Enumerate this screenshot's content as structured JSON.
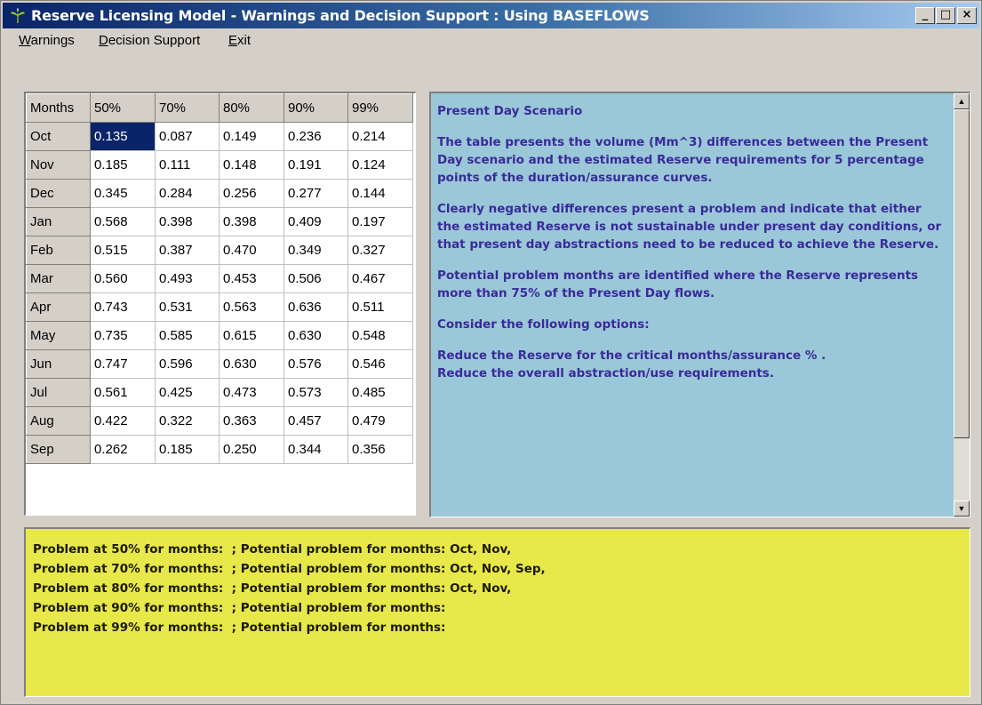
{
  "window": {
    "title": "Reserve Licensing Model - Warnings and Decision Support : Using BASEFLOWS",
    "controls": {
      "minimize": "_",
      "maximize": "□",
      "close": "×"
    }
  },
  "menu": {
    "warnings": "Warnings",
    "decision_support": "Decision Support",
    "exit": "Exit"
  },
  "table": {
    "headers": [
      "Months",
      "50%",
      "70%",
      "80%",
      "90%",
      "99%"
    ],
    "rows": [
      [
        "Oct",
        "0.135",
        "0.087",
        "0.149",
        "0.236",
        "0.214"
      ],
      [
        "Nov",
        "0.185",
        "0.111",
        "0.148",
        "0.191",
        "0.124"
      ],
      [
        "Dec",
        "0.345",
        "0.284",
        "0.256",
        "0.277",
        "0.144"
      ],
      [
        "Jan",
        "0.568",
        "0.398",
        "0.398",
        "0.409",
        "0.197"
      ],
      [
        "Feb",
        "0.515",
        "0.387",
        "0.470",
        "0.349",
        "0.327"
      ],
      [
        "Mar",
        "0.560",
        "0.493",
        "0.453",
        "0.506",
        "0.467"
      ],
      [
        "Apr",
        "0.743",
        "0.531",
        "0.563",
        "0.636",
        "0.511"
      ],
      [
        "May",
        "0.735",
        "0.585",
        "0.615",
        "0.630",
        "0.548"
      ],
      [
        "Jun",
        "0.747",
        "0.596",
        "0.630",
        "0.576",
        "0.546"
      ],
      [
        "Jul",
        "0.561",
        "0.425",
        "0.473",
        "0.573",
        "0.485"
      ],
      [
        "Aug",
        "0.422",
        "0.322",
        "0.363",
        "0.457",
        "0.479"
      ],
      [
        "Sep",
        "0.262",
        "0.185",
        "0.250",
        "0.344",
        "0.356"
      ]
    ]
  },
  "info": {
    "paragraphs": [
      "Present Day Scenario",
      "The table presents the volume (Mm^3) differences between the Present Day scenario and the estimated Reserve requirements for 5 percentage points of the duration/assurance curves.",
      "Clearly negative differences present a problem and indicate that either the estimated Reserve is not sustainable under present day conditions, or that present day abstractions need to be reduced to achieve the Reserve.",
      "Potential problem months are identified where the Reserve represents more than 75% of the Present Day flows.",
      "Consider the following options:",
      "Reduce the Reserve for the critical months/assurance % .\nReduce the overall abstraction/use requirements."
    ],
    "scroll_up": "▲",
    "scroll_down": "▼"
  },
  "warnings": [
    "Problem at 50% for months:  ; Potential problem for months: Oct, Nov,",
    "Problem at 70% for months:  ; Potential problem for months: Oct, Nov, Sep,",
    "Problem at 80% for months:  ; Potential problem for months: Oct, Nov,",
    "Problem at 90% for months:  ; Potential problem for months:",
    "Problem at 99% for months:  ; Potential problem for months:"
  ]
}
